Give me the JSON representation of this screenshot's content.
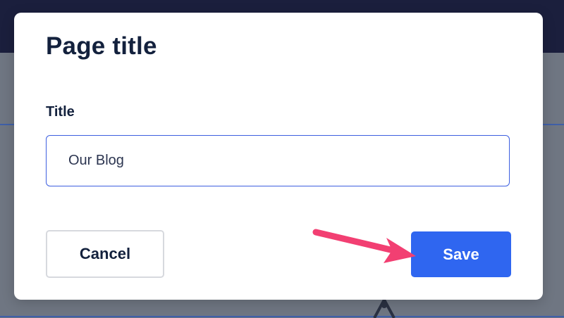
{
  "modal": {
    "title": "Page title",
    "field_label": "Title",
    "input_value": "Our Blog",
    "cancel_label": "Cancel",
    "save_label": "Save"
  },
  "colors": {
    "primary": "#2f66f0",
    "title_text": "#13213d",
    "input_border": "#3d5fe0",
    "annotation_arrow": "#f23f72",
    "backdrop": "#6f7682",
    "topbar": "#1b1f3d"
  }
}
